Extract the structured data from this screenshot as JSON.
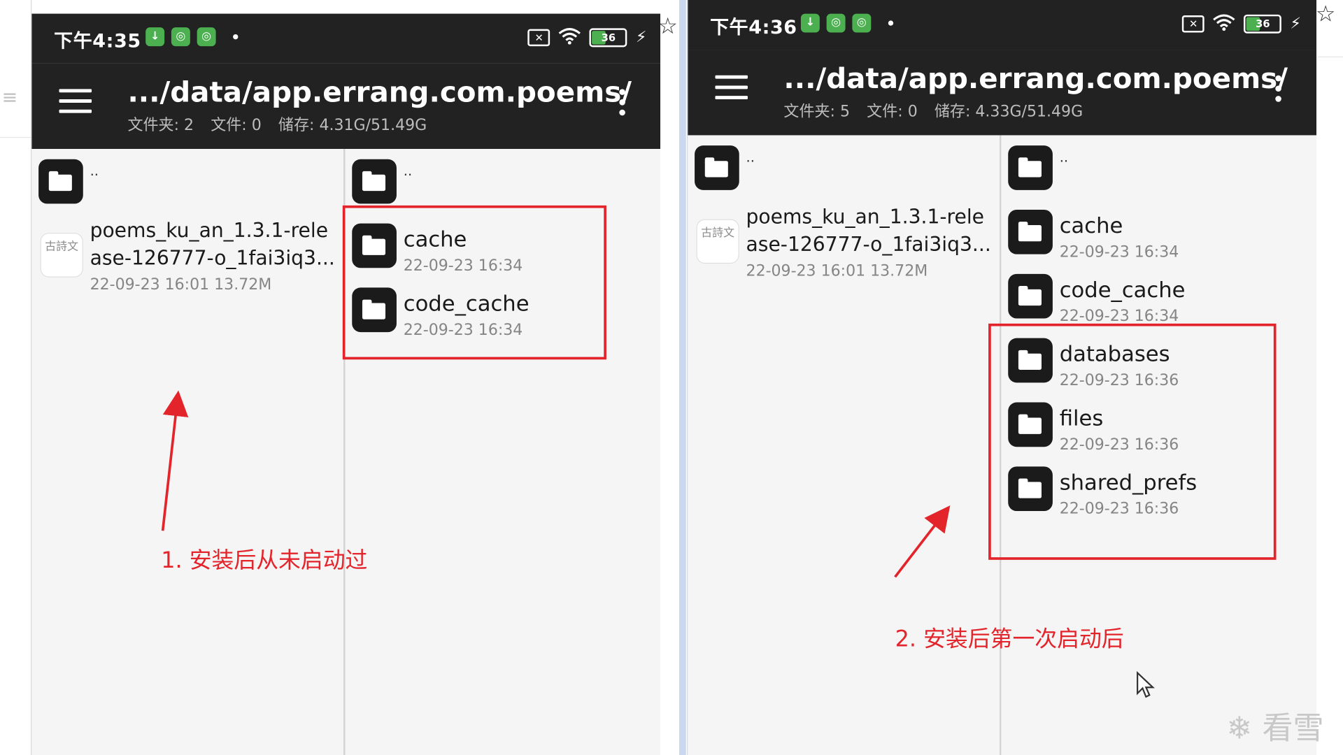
{
  "phones": [
    {
      "status": {
        "time": "下午4:35",
        "battery": "36"
      },
      "appbar": {
        "path": ".../data/app.errang.com.poems/",
        "folders": "文件夹: 2",
        "files": "文件: 0",
        "storage": "储存: 4.31G/51.49G"
      },
      "left_pane": {
        "up": "..",
        "apk": {
          "icon_text": "古詩文",
          "name_line1": "poems_ku_an_1.3.1-rele",
          "name_line2": "ase-126777-o_1fai3iq3...",
          "meta": "22-09-23 16:01  13.72M"
        }
      },
      "right_pane": {
        "up": "..",
        "items": [
          {
            "name": "cache",
            "date": "22-09-23 16:34"
          },
          {
            "name": "code_cache",
            "date": "22-09-23 16:34"
          }
        ]
      },
      "annotation": "1. 安装后从未启动过"
    },
    {
      "status": {
        "time": "下午4:36",
        "battery": "36"
      },
      "appbar": {
        "path": ".../data/app.errang.com.poems/",
        "folders": "文件夹: 5",
        "files": "文件: 0",
        "storage": "储存: 4.33G/51.49G"
      },
      "left_pane": {
        "up": "..",
        "apk": {
          "icon_text": "古詩文",
          "name_line1": "poems_ku_an_1.3.1-rele",
          "name_line2": "ase-126777-o_1fai3iq3...",
          "meta": "22-09-23 16:01  13.72M"
        }
      },
      "right_pane": {
        "up": "..",
        "items": [
          {
            "name": "cache",
            "date": "22-09-23 16:34"
          },
          {
            "name": "code_cache",
            "date": "22-09-23 16:34"
          },
          {
            "name": "databases",
            "date": "22-09-23 16:36"
          },
          {
            "name": "files",
            "date": "22-09-23 16:36"
          },
          {
            "name": "shared_prefs",
            "date": "22-09-23 16:36"
          }
        ]
      },
      "annotation": "2. 安装后第一次启动后"
    }
  ],
  "watermark": "看雪",
  "colors": {
    "bar": "#222222",
    "highlight": "#e3242b",
    "pane": "#f5f5f5"
  }
}
